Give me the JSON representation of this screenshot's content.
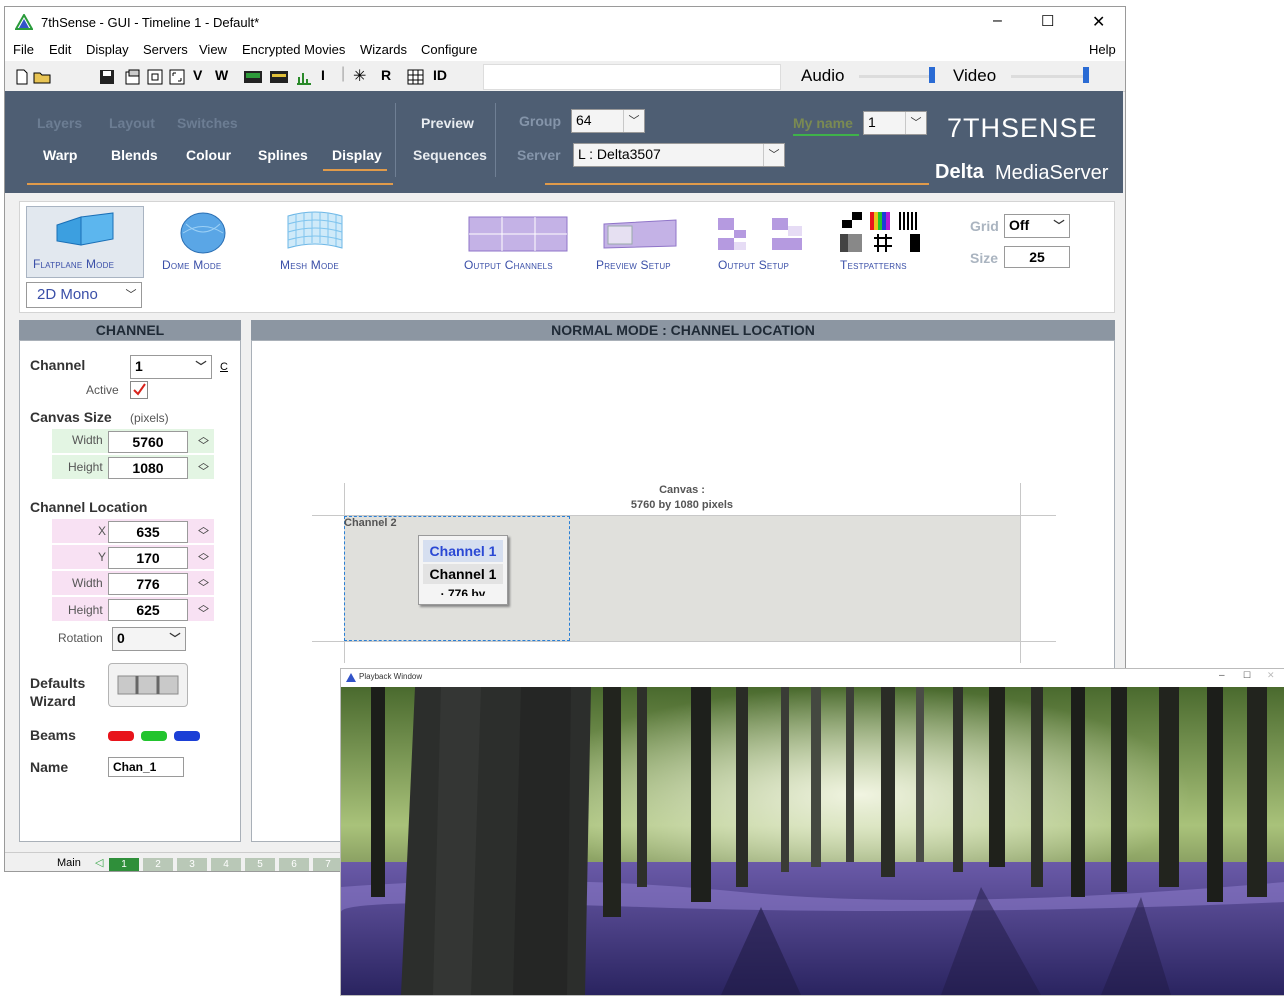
{
  "window": {
    "title": "7thSense -  GUI  - Timeline 1  - Default*",
    "min": "–",
    "max": "☐",
    "close": "✕"
  },
  "menu": [
    "File",
    "Edit",
    "Display",
    "Servers",
    "View",
    "Encrypted Movies",
    "Wizards",
    "Configure"
  ],
  "help": "Help",
  "toolbar": {
    "letters": [
      "V",
      "W",
      "I",
      "R",
      "ID"
    ],
    "audio": "Audio",
    "video": "Video"
  },
  "nav": {
    "dim_tabs": [
      "Layers",
      "Layout",
      "Switches"
    ],
    "tabs": [
      "Warp",
      "Blends",
      "Colour",
      "Splines",
      "Display"
    ],
    "active_tab": "Display",
    "preview": "Preview",
    "sequences": "Sequences",
    "group_label": "Group",
    "group_value": "64",
    "server_label": "Server",
    "server_value": "L : Delta3507",
    "myname_label": "My name",
    "myname_value": "1",
    "brand": "7THSENSE",
    "product_bold": "Delta",
    "product_rest": "MediaServer"
  },
  "modes": {
    "flatplane": "Flatplane Mode",
    "dome": "Dome Mode",
    "mesh": "Mesh Mode",
    "stereo_value": "2D Mono",
    "output_channels": "Output Channels",
    "preview_setup": "Preview Setup",
    "output_setup": "Output Setup",
    "testpatterns": "Testpatterns",
    "grid_label": "Grid",
    "grid_value": "Off",
    "size_label": "Size",
    "size_value": "25"
  },
  "channel_panel": {
    "header": "CHANNEL",
    "channel_label": "Channel",
    "channel_value": "1",
    "c_button": "C",
    "active_label": "Active",
    "canvas_size_label": "Canvas Size",
    "pixels_label": "(pixels)",
    "width_label": "Width",
    "width_value": "5760",
    "height_label": "Height",
    "height_value": "1080",
    "location_label": "Channel Location",
    "x_label": "X",
    "x_value": "635",
    "y_label": "Y",
    "y_value": "170",
    "loc_width_label": "Width",
    "loc_width_value": "776",
    "loc_height_label": "Height",
    "loc_height_value": "625",
    "rotation_label": "Rotation",
    "rotation_value": "0",
    "defaults_label_1": "Defaults",
    "defaults_label_2": "Wizard",
    "beams_label": "Beams",
    "beam_colors": [
      "#e8141b",
      "#22c42e",
      "#1b3fd6"
    ],
    "name_label": "Name",
    "name_value": "Chan_1"
  },
  "main_panel": {
    "header": "NORMAL MODE : CHANNEL LOCATION",
    "canvas_label": "Canvas :",
    "canvas_size_text": "5760 by 1080 pixels",
    "channel2_label": "Channel 2",
    "channel1_title": "Channel 1",
    "channel1_sub": "Channel 1",
    "channel1_dims": "· 776 by"
  },
  "status": {
    "main": "Main",
    "pages": [
      "1",
      "2",
      "3",
      "4",
      "5",
      "6",
      "7"
    ],
    "active_page": "1"
  },
  "playback": {
    "title": "Playback Window",
    "min": "–",
    "max": "☐",
    "close": "✕"
  }
}
